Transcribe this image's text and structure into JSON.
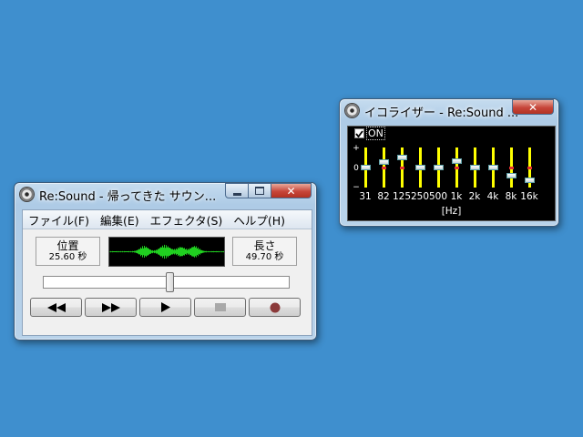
{
  "main_window": {
    "title": "Re:Sound - 帰ってきた サウン...",
    "menu": [
      "ファイル(F)",
      "編集(E)",
      "エフェクタ(S)",
      "ヘルプ(H)"
    ],
    "position_label": "位置",
    "position_value": "25.60 秒",
    "length_label": "長さ",
    "length_value": "49.70 秒",
    "seek_progress": 0.516,
    "waveform_color": "#20d020",
    "transport_buttons": [
      {
        "name": "rewind-button",
        "icon": "rewind-icon",
        "color": "#000000"
      },
      {
        "name": "fast-forward-button",
        "icon": "fast-forward-icon",
        "color": "#000000"
      },
      {
        "name": "play-button",
        "icon": "play-icon",
        "color": "#000000"
      },
      {
        "name": "stop-button",
        "icon": "stop-icon",
        "color": "#a8a8a8"
      },
      {
        "name": "record-button",
        "icon": "record-icon",
        "color": "#8b3a3a"
      }
    ]
  },
  "eq_window": {
    "title": "イコライザー - Re:Sound ...",
    "enabled": true,
    "on_label": "ON",
    "scale": {
      "plus": "+",
      "zero": "0",
      "minus": "−"
    },
    "unit_label": "[Hz]",
    "bar_color": "#ffff00",
    "bands": [
      {
        "freq": "31",
        "level": 0.0
      },
      {
        "freq": "82",
        "level": 0.3
      },
      {
        "freq": "125",
        "level": 0.55
      },
      {
        "freq": "250",
        "level": 0.0
      },
      {
        "freq": "500",
        "level": 0.0
      },
      {
        "freq": "1k",
        "level": 0.35
      },
      {
        "freq": "2k",
        "level": 0.0
      },
      {
        "freq": "4k",
        "level": 0.0
      },
      {
        "freq": "8k",
        "level": -0.45
      },
      {
        "freq": "16k",
        "level": -0.7
      }
    ]
  }
}
